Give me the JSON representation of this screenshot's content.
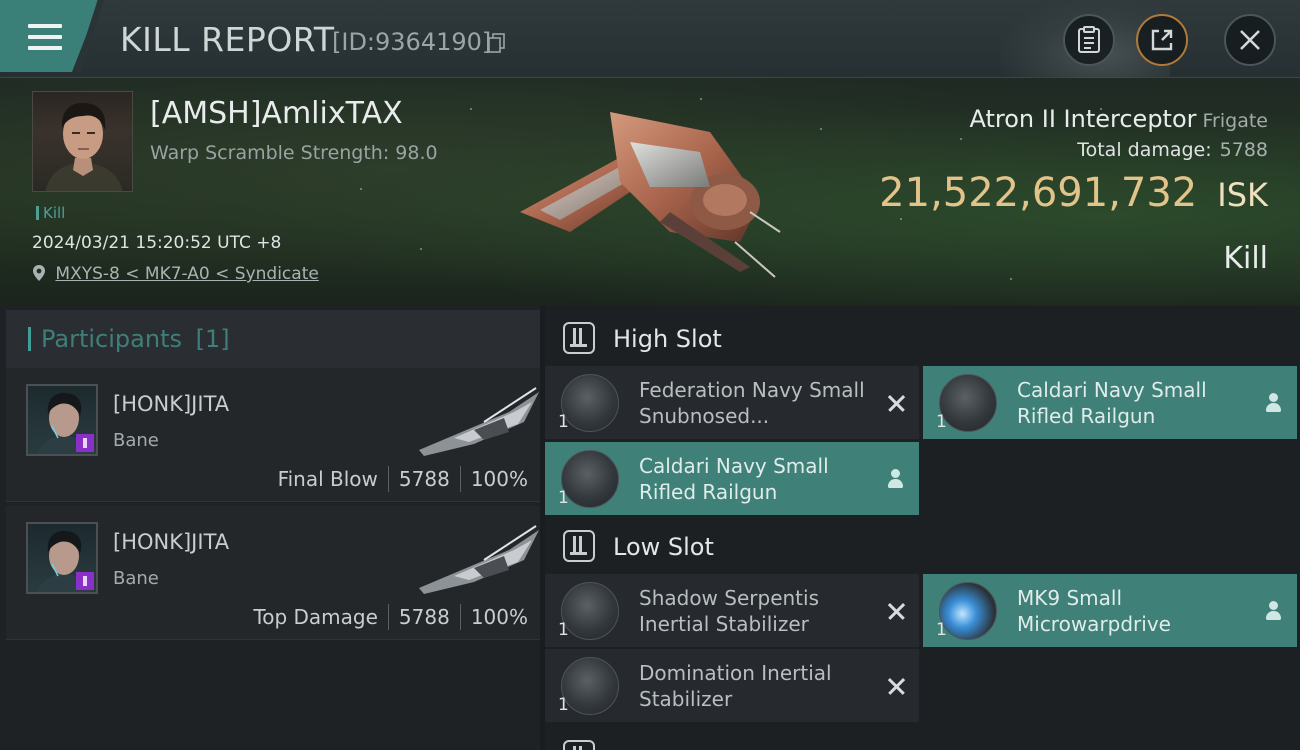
{
  "topbar": {
    "title": "KILL REPORT",
    "report_id": "[ID:9364190]",
    "icons": {
      "menu": "hamburger-menu-icon",
      "copy": "copy-icon",
      "clipboard": "clipboard-icon",
      "share": "share-external-icon",
      "close": "close-icon"
    },
    "accent_color": "#3a7f78",
    "share_border_color": "#b07a3a"
  },
  "victim": {
    "name": "[AMSH]AmlixTAX",
    "warp_scramble": "Warp Scramble Strength: 98.0",
    "tag": "Kill",
    "datetime": "2024/03/21 15:20:52 UTC +8",
    "location": "MXYS-8 < MK7-A0 < Syndicate",
    "ship_name": "Atron II Interceptor",
    "ship_class": "Frigate",
    "total_damage_label": "Total damage:",
    "total_damage_value": "5788",
    "isk_value": "21,522,691,732",
    "isk_unit": "ISK",
    "result": "Kill",
    "isk_color": "#e2c48a"
  },
  "participants": {
    "title": "Participants",
    "count": "[1]",
    "rows": [
      {
        "name": "[HONK]JITA",
        "ship": "Bane",
        "role": "Final Blow",
        "damage": "5788",
        "percent": "100%"
      },
      {
        "name": "[HONK]JITA",
        "ship": "Bane",
        "role": "Top Damage",
        "damage": "5788",
        "percent": "100%"
      }
    ]
  },
  "fitting": {
    "high_slot": {
      "label": "High Slot",
      "modules": [
        {
          "name": "Federation Navy Small Snubnosed...",
          "qty": "1",
          "state": "destroyed"
        },
        {
          "name": "Caldari Navy Small Rifled Railgun",
          "qty": "1",
          "state": "dropped"
        },
        {
          "name": "Caldari Navy Small Rifled Railgun",
          "qty": "1",
          "state": "dropped"
        }
      ]
    },
    "low_slot": {
      "label": "Low Slot",
      "modules": [
        {
          "name": "Shadow Serpentis Inertial Stabilizer",
          "qty": "1",
          "state": "destroyed"
        },
        {
          "name": "MK9 Small Microwarpdrive",
          "qty": "1",
          "state": "dropped"
        },
        {
          "name": "Domination Inertial Stabilizer",
          "qty": "1",
          "state": "destroyed"
        }
      ]
    },
    "dropped_color": "#3f8079"
  }
}
